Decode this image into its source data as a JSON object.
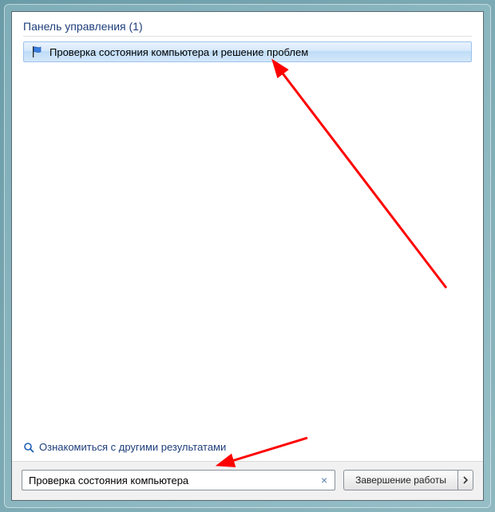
{
  "section": {
    "title": "Панель управления (1)"
  },
  "results": {
    "item0": {
      "label": "Проверка состояния компьютера и решение проблем"
    }
  },
  "more_results": {
    "label": "Ознакомиться с другими результатами"
  },
  "search": {
    "value": "Проверка состояния компьютера"
  },
  "shutdown": {
    "label": "Завершение работы"
  }
}
